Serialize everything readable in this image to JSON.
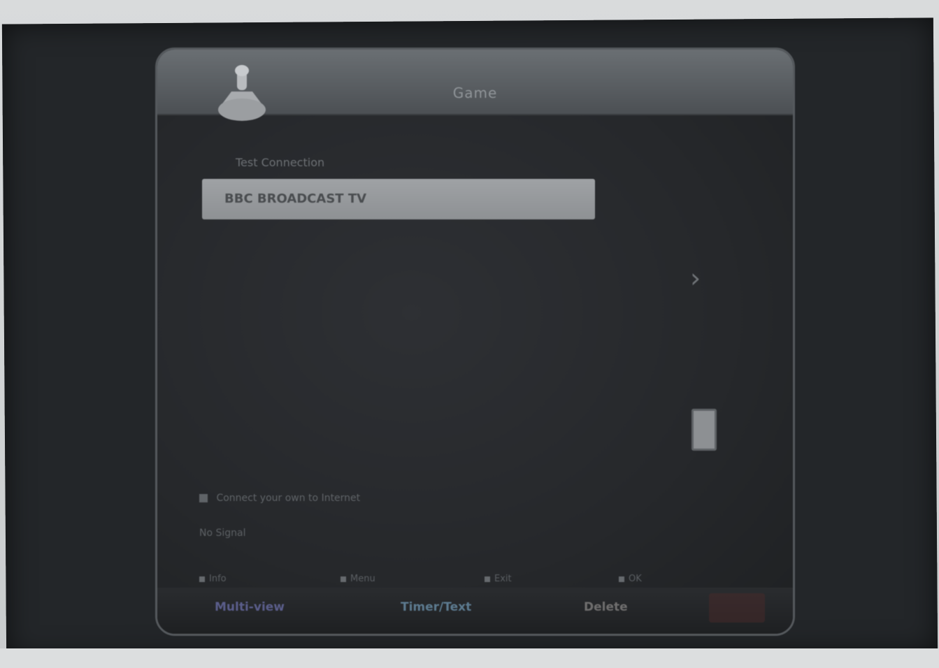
{
  "title_bar": {
    "title": "Game",
    "logo_icon": "joystick-icon"
  },
  "subtitle": "Test Connection",
  "list": {
    "selected_row_text": "BBC  BROADCAST TV"
  },
  "scroll": {
    "arrow_icon": "chevron-right-icon",
    "thumb_label": "▯"
  },
  "info": {
    "line": "Connect your own to Internet",
    "status": "No Signal"
  },
  "options": [
    {
      "label": "Info"
    },
    {
      "label": "Menu"
    },
    {
      "label": "Exit"
    },
    {
      "label": "OK"
    }
  ],
  "bottom_bar": {
    "buttons": [
      {
        "label": "Multi-view",
        "color": "#5a5d8a"
      },
      {
        "label": "Timer/Text",
        "color": "#5c7a8f"
      },
      {
        "label": "Delete",
        "color": "#6f6e6e"
      }
    ]
  }
}
